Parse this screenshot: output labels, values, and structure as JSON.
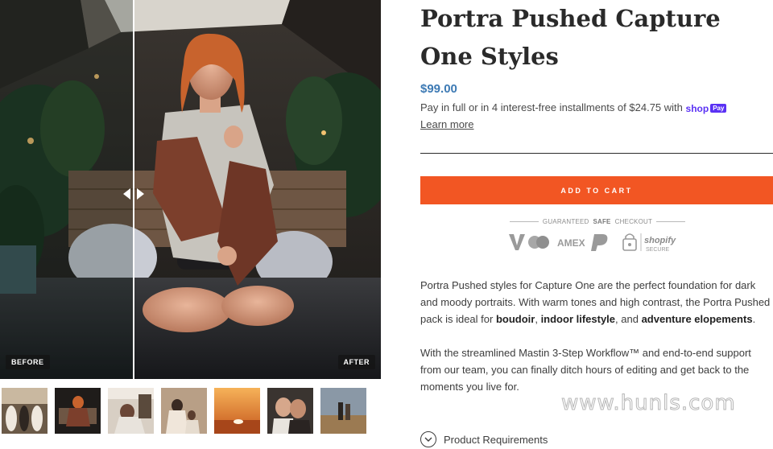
{
  "gallery": {
    "before_label": "BEFORE",
    "after_label": "AFTER",
    "thumbnails": [
      {
        "name": "thumb-wedding-group"
      },
      {
        "name": "thumb-woman-sweater"
      },
      {
        "name": "thumb-woman-interior"
      },
      {
        "name": "thumb-mother-child"
      },
      {
        "name": "thumb-desert-sunset"
      },
      {
        "name": "thumb-couple-closeup"
      },
      {
        "name": "thumb-couple-field"
      }
    ]
  },
  "product": {
    "title": "Portra Pushed Capture One Styles",
    "price": "$99.00",
    "installments_text": "Pay in full or in 4 interest-free installments of $24.75 with",
    "shoppay_shop": "shop",
    "shoppay_pay": "Pay",
    "learn_more": "Learn more",
    "add_to_cart": "ADD TO CART"
  },
  "trust_badge": {
    "label_prefix": "GUARANTEED",
    "label_safe": "SAFE",
    "label_suffix": "CHECKOUT",
    "icons": [
      "visa-icon",
      "mastercard-icon",
      "amex-icon",
      "paypal-icon",
      "lock-icon",
      "shopify-secure-icon"
    ],
    "amex_text": "AMEX",
    "shopify_text": "shopify",
    "secure_text": "SECURE"
  },
  "description": {
    "p1_text": "Portra Pushed styles for Capture One are the perfect foundation for dark and moody portraits. With warm tones and high contrast, the Portra Pushed pack is ideal for ",
    "p1_bold1": "boudoir",
    "p1_sep1": ", ",
    "p1_bold2": "indoor lifestyle",
    "p1_sep2": ", and ",
    "p1_bold3": "adventure elopements",
    "p1_end": ".",
    "p2_text": "With the streamlined Mastin 3-Step Workflow™ and end-to-end support from our team, you can finally ditch hours of editing and get back to the moments you live for."
  },
  "accordion": {
    "product_requirements": "Product Requirements"
  },
  "watermark": "www.hunls.com",
  "colors": {
    "accent": "#f25623",
    "price": "#3d7ab4",
    "shoppay": "#5a31f4"
  }
}
